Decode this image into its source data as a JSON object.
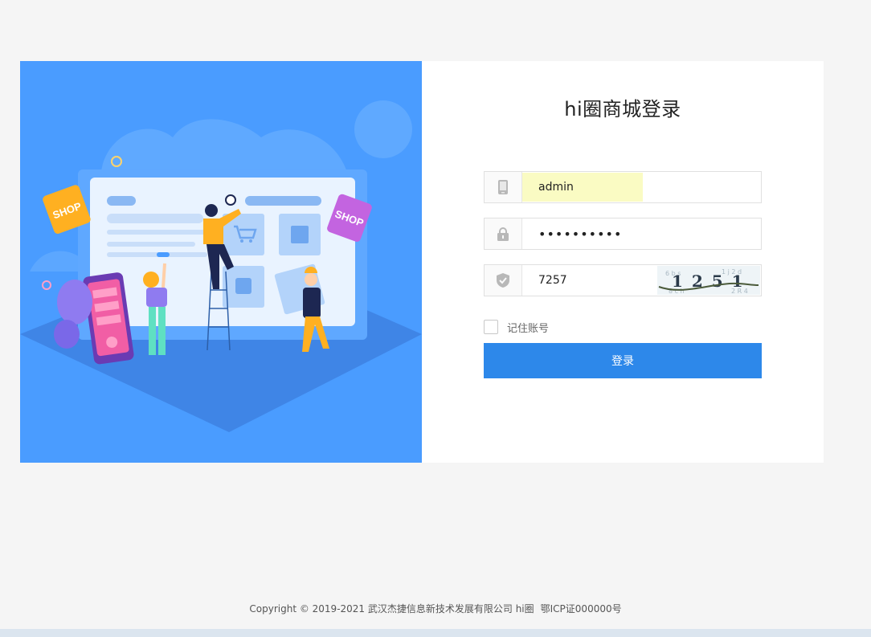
{
  "login": {
    "title": "hi圈商城登录",
    "username_value": "admin",
    "password_value": "••••••••••",
    "captcha_value": "7257",
    "captcha_image_text": "1 2 5 1",
    "remember_label": "记住账号",
    "submit_label": "登录"
  },
  "illustration": {
    "shop_badge_left": "SHOP",
    "shop_badge_right": "SHOP"
  },
  "footer": {
    "copyright": "Copyright © 2019-2021 武汉杰捷信息新技术发展有限公司 hi圈",
    "icp": "鄂ICP证000000号"
  },
  "icons": {
    "username": "phone-icon",
    "password": "lock-icon",
    "captcha": "shield-check-icon"
  },
  "colors": {
    "accent": "#2d88ea",
    "illustration_bg": "#4a9cff",
    "page_bg": "#f5f5f5"
  }
}
